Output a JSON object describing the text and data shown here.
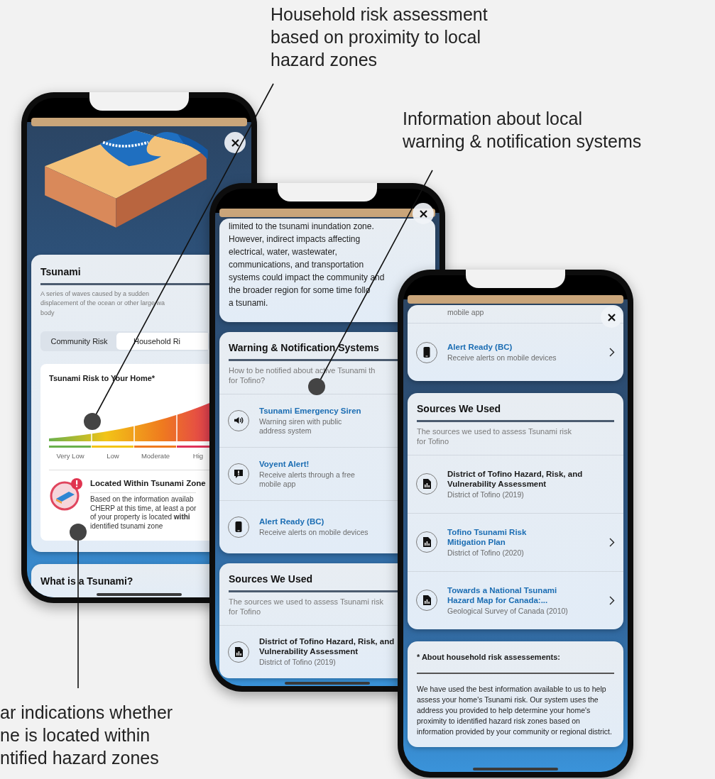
{
  "annotations": [
    {
      "lines": [
        "Household risk assessment",
        "based on proximity to local",
        "hazard zones"
      ]
    },
    {
      "lines": [
        "Information about local",
        "warning & notification systems"
      ]
    },
    {
      "lines": [
        "ar indications whether",
        "ne is located within",
        "ntified hazard zones"
      ]
    }
  ],
  "phones": [
    {
      "cards": [
        {
          "kind": "illustration"
        },
        {
          "kind": "hazard",
          "title": "Tsunami",
          "description_lines": [
            "A series of waves caused by a sudden",
            "displacement of the ocean or other large wa",
            "body"
          ],
          "tabs": [
            {
              "label": "Community Risk",
              "selected": false
            },
            {
              "label": "Household Ri",
              "selected": true
            }
          ],
          "risk": {
            "title": "Tsunami Risk to Your Home*",
            "levels": [
              {
                "label": "Very Low",
                "color": "#6ab04c"
              },
              {
                "label": "Low",
                "color": "#f2c417"
              },
              {
                "label": "Moderate",
                "color": "#ef7a1f"
              },
              {
                "label": "Hig",
                "color": "#e0345a"
              }
            ]
          },
          "zone_alert": {
            "title": "Located Within Tsunami Zone",
            "lines": [
              "Based on the information availab",
              "CHERP at this time, at least a por",
              "of your property is located **withi**",
              "identified tsunami zone"
            ]
          }
        },
        {
          "kind": "heading",
          "title": "What is a Tsunami?"
        }
      ]
    },
    {
      "cards": [
        {
          "kind": "text",
          "lines": [
            "limited to the tsunami inundation zone.",
            "However, indirect impacts affecting",
            "electrical, water, wastewater,",
            "communications, and transportation",
            "systems could impact the community and",
            "the broader region for some time follo",
            "a tsunami."
          ]
        },
        {
          "kind": "list",
          "title": "Warning & Notification Systems",
          "subtitle_lines": [
            "How to be notified about active Tsunami th",
            "for Tofino?"
          ],
          "items": [
            {
              "kind": "siren",
              "title": "Tsunami Emergency Siren",
              "desc_lines": [
                "Warning siren with public",
                "address system"
              ],
              "linked": true
            },
            {
              "kind": "app-alert",
              "title": "Voyent Alert!",
              "desc_lines": [
                "Receive alerts through a free",
                "mobile app"
              ],
              "linked": true
            },
            {
              "kind": "mobile-alert",
              "title": "Alert Ready (BC)",
              "desc_lines": [
                "Receive alerts on mobile devices"
              ],
              "linked": true
            }
          ]
        },
        {
          "kind": "list",
          "title": "Sources We Used",
          "subtitle_lines": [
            "The sources we used to assess Tsunami risk",
            "for Tofino"
          ],
          "items": [
            {
              "kind": "source",
              "title_lines": [
                "District of Tofino Hazard, Risk, and",
                "Vulnerability Assessment"
              ],
              "desc_lines": [
                "District of Tofino (2019)"
              ],
              "linked": false
            }
          ]
        }
      ]
    },
    {
      "cards": [
        {
          "kind": "list",
          "items": [
            {
              "kind": "fragment",
              "desc_lines": [
                "mobile app"
              ]
            },
            {
              "kind": "mobile-alert",
              "title": "Alert Ready (BC)",
              "desc_lines": [
                "Receive alerts on mobile devices"
              ],
              "linked": true,
              "chevron": true
            }
          ]
        },
        {
          "kind": "list",
          "title": "Sources We Used",
          "subtitle_lines": [
            "The sources we used to assess Tsunami risk",
            "for Tofino"
          ],
          "items": [
            {
              "kind": "source",
              "title_lines": [
                "District of Tofino Hazard, Risk, and",
                "Vulnerability Assessment"
              ],
              "desc_lines": [
                "District of Tofino (2019)"
              ],
              "linked": false
            },
            {
              "kind": "source",
              "title_lines": [
                "Tofino Tsunami Risk",
                "Mitigation Plan"
              ],
              "desc_lines": [
                "District of Tofino (2020)"
              ],
              "linked": true,
              "chevron": true
            },
            {
              "kind": "source",
              "title_lines": [
                "Towards a National Tsunami",
                "Hazard Map for Canada:..."
              ],
              "desc_lines": [
                "Geological Survey of Canada (2010)"
              ],
              "linked": true,
              "chevron": true
            }
          ]
        },
        {
          "kind": "note",
          "title": "* About household risk assessements:",
          "text": "We have used the best information available to us to help assess your home's Tsunami risk. Our system uses the address you provided to help determine your home's proximity to identified hazard risk zones based on information provided by your community or regional district."
        }
      ]
    }
  ]
}
